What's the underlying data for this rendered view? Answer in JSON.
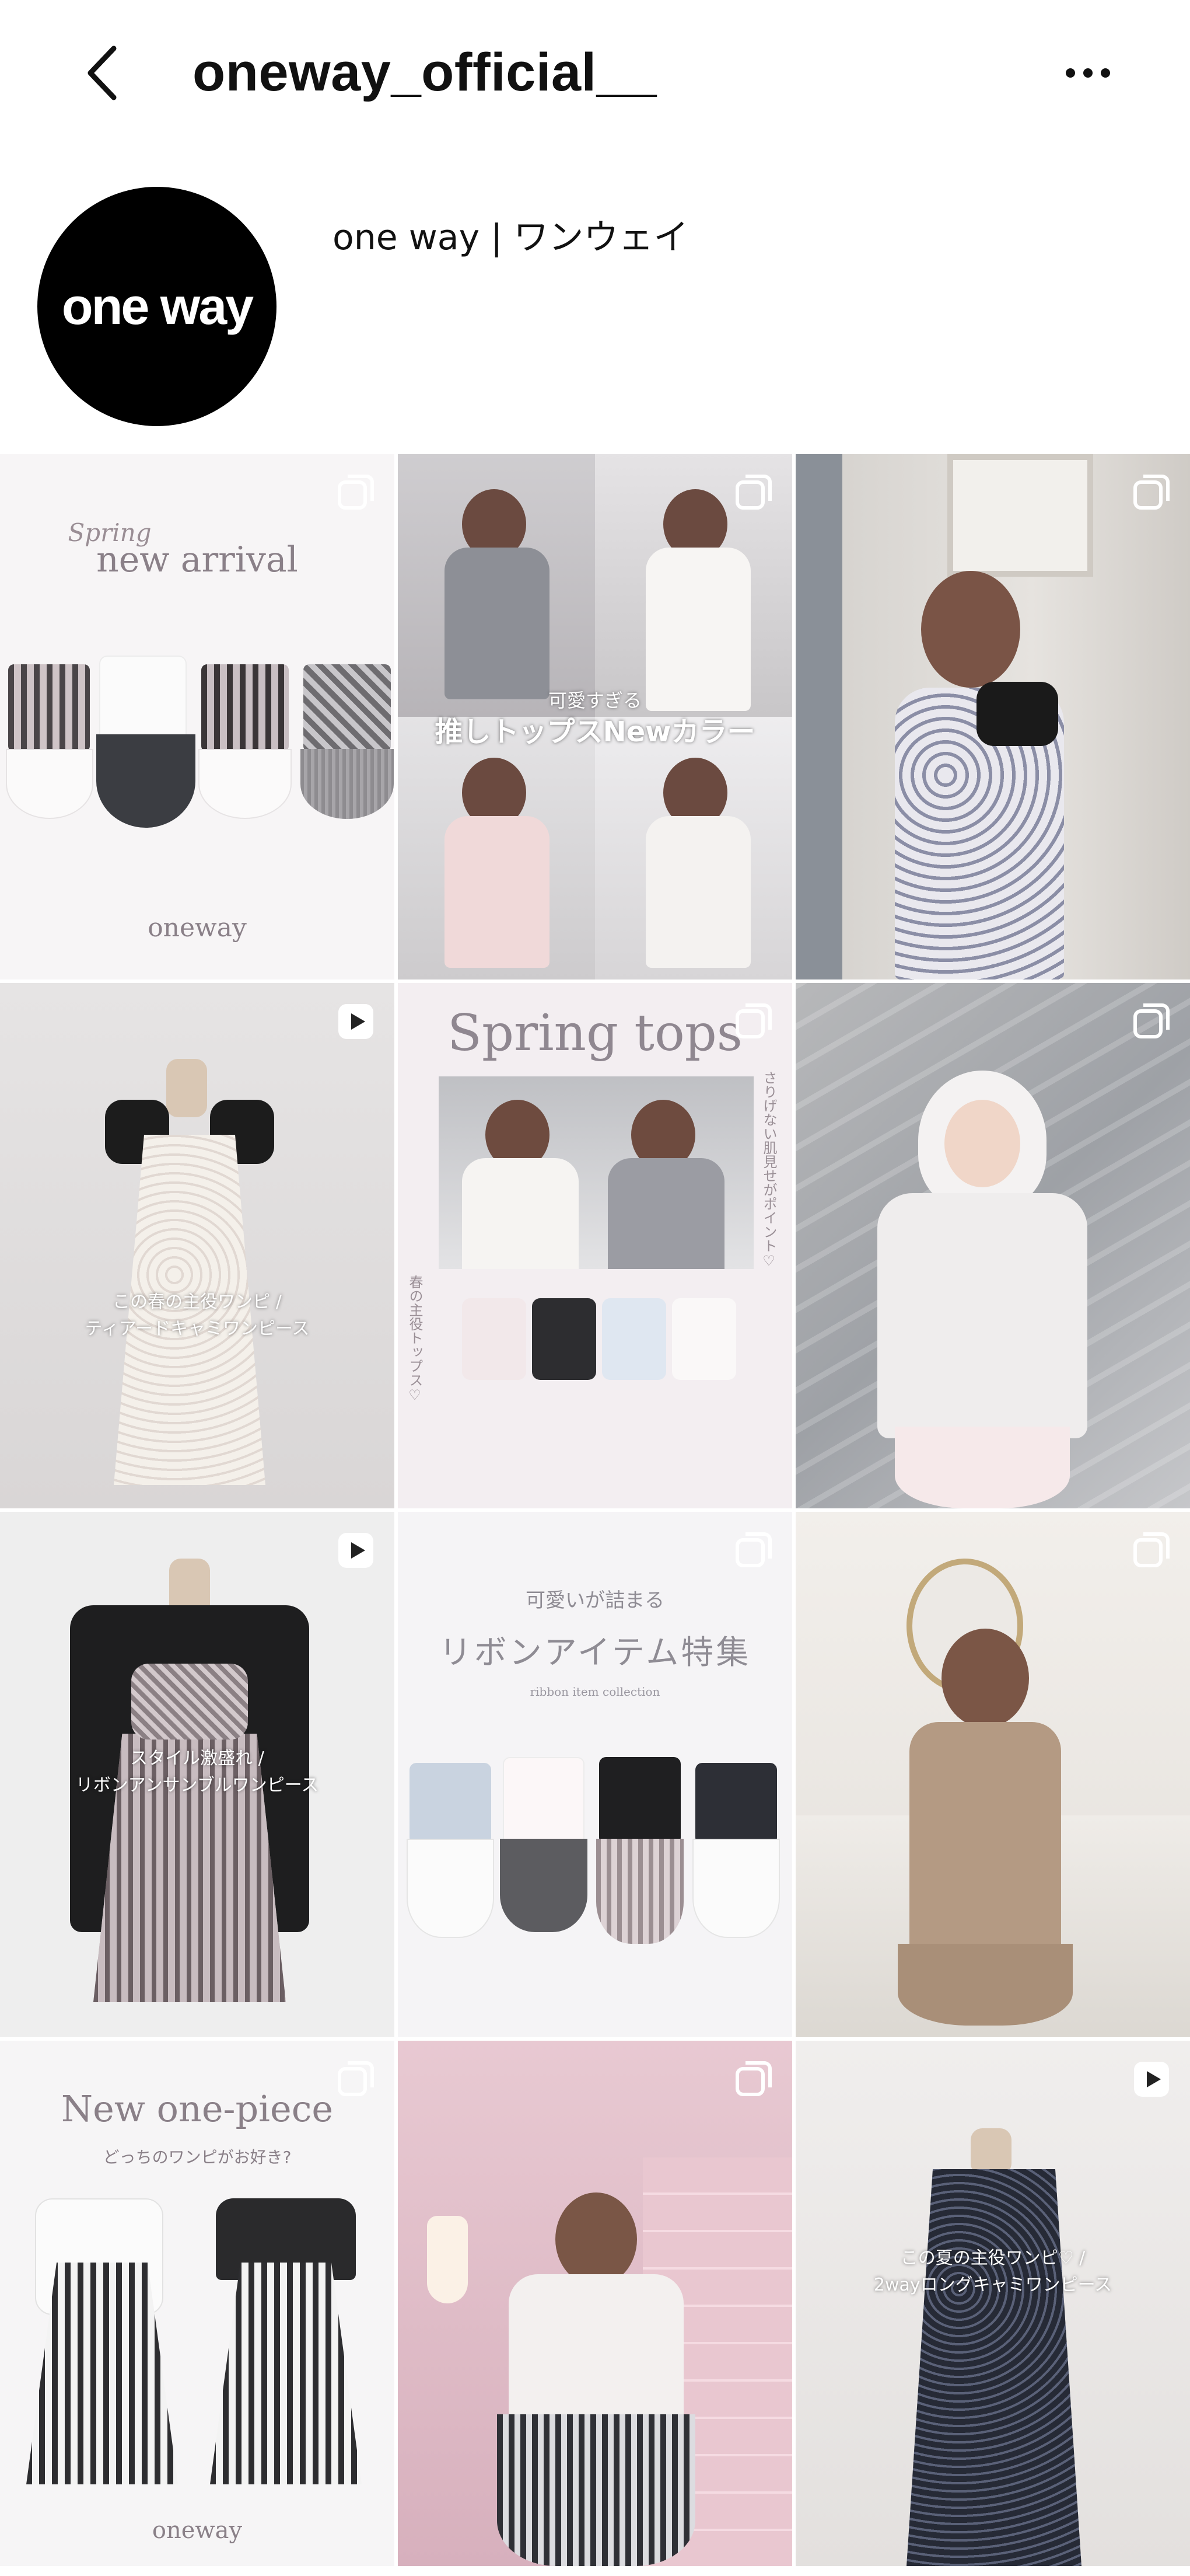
{
  "header": {
    "username": "oneway_official__",
    "back_icon": "chevron-left-icon",
    "more_icon": "ellipsis-icon"
  },
  "profile": {
    "avatar_text": "one way",
    "display_name": "one way | ワンウェイ"
  },
  "posts": [
    {
      "type": "carousel",
      "title_script": "Spring",
      "title": "new arrival",
      "footer": "oneway"
    },
    {
      "type": "carousel",
      "caption_line1": "可愛すぎる",
      "caption_line2": "推しトップスNewカラー"
    },
    {
      "type": "carousel"
    },
    {
      "type": "reel",
      "caption_line1": "この春の主役ワンピ /",
      "caption_line2": "ティアードキャミワンピース"
    },
    {
      "type": "carousel",
      "title": "Spring tops",
      "side_left": "春の主役トップス♡",
      "side_right": "さりげない肌見せがポイント♡"
    },
    {
      "type": "carousel"
    },
    {
      "type": "reel",
      "caption_line1": "スタイル激盛れ /",
      "caption_line2": "リボンアンサンブルワンピース"
    },
    {
      "type": "carousel",
      "heading_small": "可愛いが詰まる",
      "title": "リボンアイテム特集",
      "subtitle": "ribbon item collection"
    },
    {
      "type": "carousel"
    },
    {
      "type": "carousel",
      "title": "New one-piece",
      "subtitle": "どっちのワンピがお好き?",
      "footer": "oneway"
    },
    {
      "type": "carousel"
    },
    {
      "type": "reel",
      "caption_line1": "この夏の主役ワンピ♡ /",
      "caption_line2": "2wayロングキャミワンピース"
    }
  ],
  "colors": {
    "background": "#ffffff",
    "text": "#111111",
    "avatar_bg": "#000000",
    "tile_light": "#f4f2f3",
    "accent_pink": "#e59bb4"
  }
}
